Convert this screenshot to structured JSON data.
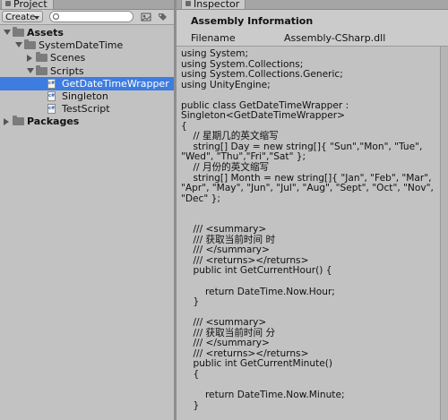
{
  "project": {
    "tab_label": "Project",
    "create_label": "Create",
    "search": {
      "value": "",
      "placeholder": ""
    },
    "tree": [
      {
        "label": "Assets",
        "bold": true,
        "depth": 0,
        "expand": "open",
        "icon": "folder-icon",
        "selected": false
      },
      {
        "label": "SystemDateTime",
        "bold": false,
        "depth": 1,
        "expand": "open",
        "icon": "folder-icon",
        "selected": false
      },
      {
        "label": "Scenes",
        "bold": false,
        "depth": 2,
        "expand": "closed",
        "icon": "folder-icon",
        "selected": false
      },
      {
        "label": "Scripts",
        "bold": false,
        "depth": 2,
        "expand": "open",
        "icon": "folder-icon",
        "selected": false
      },
      {
        "label": "GetDateTimeWrapper",
        "bold": false,
        "depth": 3,
        "expand": "none",
        "icon": "script-icon",
        "selected": true
      },
      {
        "label": "Singleton",
        "bold": false,
        "depth": 3,
        "expand": "none",
        "icon": "script-icon",
        "selected": false
      },
      {
        "label": "TestScript",
        "bold": false,
        "depth": 3,
        "expand": "none",
        "icon": "script-icon",
        "selected": false
      },
      {
        "label": "Packages",
        "bold": true,
        "depth": 0,
        "expand": "closed",
        "icon": "folder-icon",
        "selected": false
      }
    ],
    "script_icon_text": "c#"
  },
  "inspector": {
    "tab_label": "Inspector",
    "title": "Assembly Information",
    "filename_label": "Filename",
    "filename_value": "Assembly-CSharp.dll",
    "code_lines": [
      "using System;",
      "using System.Collections;",
      "using System.Collections.Generic;",
      "using UnityEngine;",
      "",
      "public class GetDateTimeWrapper :",
      "Singleton<GetDateTimeWrapper>",
      "{",
      "    // 星期几的英文缩写",
      "    string[] Day = new string[]{ \"Sun\",\"Mon\", \"Tue\",",
      "\"Wed\", \"Thu\",\"Fri\",\"Sat\" };",
      "    // 月份的英文缩写",
      "    string[] Month = new string[]{ \"Jan\", \"Feb\", \"Mar\",",
      "\"Apr\", \"May\", \"Jun\", \"Jul\", \"Aug\", \"Sept\", \"Oct\", \"Nov\",",
      "\"Dec\" };",
      "",
      "",
      "    /// <summary>",
      "    /// 获取当前时间 时",
      "    /// </summary>",
      "    /// <returns></returns>",
      "    public int GetCurrentHour() {",
      "",
      "        return DateTime.Now.Hour;",
      "    }",
      "",
      "    /// <summary>",
      "    /// 获取当前时间 分",
      "    /// </summary>",
      "    /// <returns></returns>",
      "    public int GetCurrentMinute()",
      "    {",
      "",
      "        return DateTime.Now.Minute;",
      "    }",
      "",
      "    ///"
    ]
  }
}
